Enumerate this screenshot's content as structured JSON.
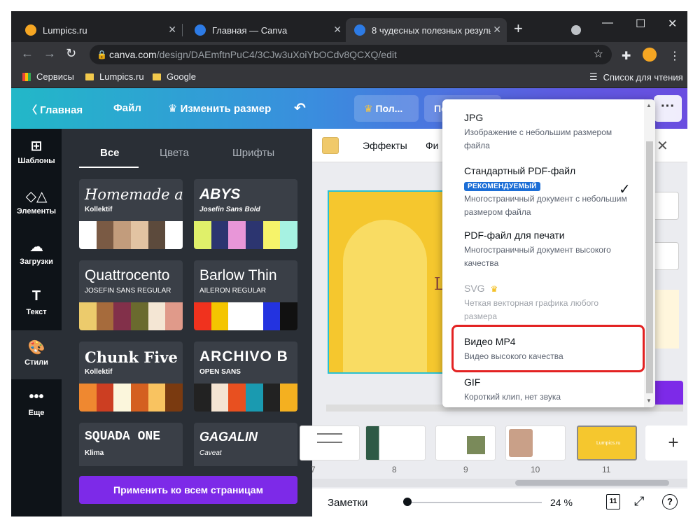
{
  "browser": {
    "tabs": [
      {
        "title": "Lumpics.ru",
        "color": "#f5a623"
      },
      {
        "title": "Главная — Canva",
        "color": "#2d7be5"
      },
      {
        "title": "8 чудесных полезных результа",
        "color": "#2d7be5"
      }
    ],
    "url_host": "canva.com",
    "url_path": "/design/DAEmftnPuC4/3CJw3uXoiYbOCdv8QCXQ/edit",
    "bookmarks": [
      "Сервисы",
      "Lumpics.ru",
      "Google"
    ],
    "reading_list": "Список для чтения"
  },
  "header": {
    "home": "Главная",
    "file": "Файл",
    "resize": "Изменить размер",
    "share_partial": "Пол...",
    "sub_partial": "Под"
  },
  "sidebar": {
    "items": [
      {
        "label": "Шаблоны",
        "icon": "⊞"
      },
      {
        "label": "Элементы",
        "icon": "◇△"
      },
      {
        "label": "Загрузки",
        "icon": "☁"
      },
      {
        "label": "Текст",
        "icon": "T"
      },
      {
        "label": "Стили",
        "icon": "🎨"
      },
      {
        "label": "Еще",
        "icon": "•••"
      }
    ]
  },
  "styles_panel": {
    "tabs": [
      "Все",
      "Цвета",
      "Шрифты"
    ],
    "cards": [
      {
        "title": "Homemade a",
        "subtitle": "Kollektif",
        "palette": [
          "#ffffff",
          "#7a5a44",
          "#c29c7c",
          "#e2c3a2",
          "#5c4a3c",
          "#ffffff"
        ]
      },
      {
        "title": "ABYS",
        "subtitle": "Josefin Sans Bold",
        "palette": [
          "#e0f06a",
          "#2c3570",
          "#e896d8",
          "#2c3570",
          "#f6f36a",
          "#a6f2e2"
        ]
      },
      {
        "title": "Quattrocento",
        "subtitle": "JOSEFIN SANS REGULAR",
        "palette": [
          "#eccb6c",
          "#a66b3c",
          "#82304a",
          "#6a6a2e",
          "#f4e6d4",
          "#e09a8a"
        ]
      },
      {
        "title": "Barlow Thin",
        "subtitle": "AILERON REGULAR",
        "palette": [
          "#f0321e",
          "#f4c500",
          "#ffffff",
          "#ffffff",
          "#2333e0",
          "#111111"
        ]
      },
      {
        "title": "Chunk Five",
        "subtitle": "Kollektif",
        "palette": [
          "#ef8830",
          "#cc3e22",
          "#fbf6dc",
          "#d46020",
          "#f9c360",
          "#7a3a10"
        ]
      },
      {
        "title": "ARCHIVO B",
        "subtitle": "OPEN SANS",
        "palette": [
          "#222222",
          "#f4e4d2",
          "#e85020",
          "#1a9ab0",
          "#222222",
          "#f4b020"
        ]
      },
      {
        "title": "SQUADA ONE",
        "subtitle": "Klima",
        "palette": []
      },
      {
        "title": "GAGALIN",
        "subtitle": "Caveat",
        "palette": []
      }
    ],
    "apply_button": "Применить ко всем страницам"
  },
  "editor": {
    "effects": "Эффекты",
    "filter_partial": "Фи",
    "slide_text": "L",
    "thumbnails": [
      {
        "num": "7",
        "type": "text"
      },
      {
        "num": "8",
        "type": "green"
      },
      {
        "num": "9",
        "type": "photo"
      },
      {
        "num": "10",
        "type": "person"
      },
      {
        "num": "11",
        "type": "yellow",
        "label": "Lumpics.ru"
      }
    ],
    "notes": "Заметки",
    "zoom": "24 %",
    "page_count": "11",
    "help": "?"
  },
  "download_menu": {
    "items": [
      {
        "title": "JPG",
        "desc": "Изображение с небольшим размером файла"
      },
      {
        "title": "Стандартный PDF-файл",
        "badge": "РЕКОМЕНДУЕМЫЙ",
        "desc": "Многостраничный документ с небольшим размером файла",
        "selected": true
      },
      {
        "title": "PDF-файл для печати",
        "desc": "Многостраничный документ высокого качества"
      },
      {
        "title": "SVG",
        "desc": "Четкая векторная графика любого размера",
        "disabled": true
      },
      {
        "title": "Видео MP4",
        "desc": "Видео высокого качества",
        "highlighted": true
      },
      {
        "title": "GIF",
        "desc": "Короткий клип, нет звука"
      }
    ]
  }
}
